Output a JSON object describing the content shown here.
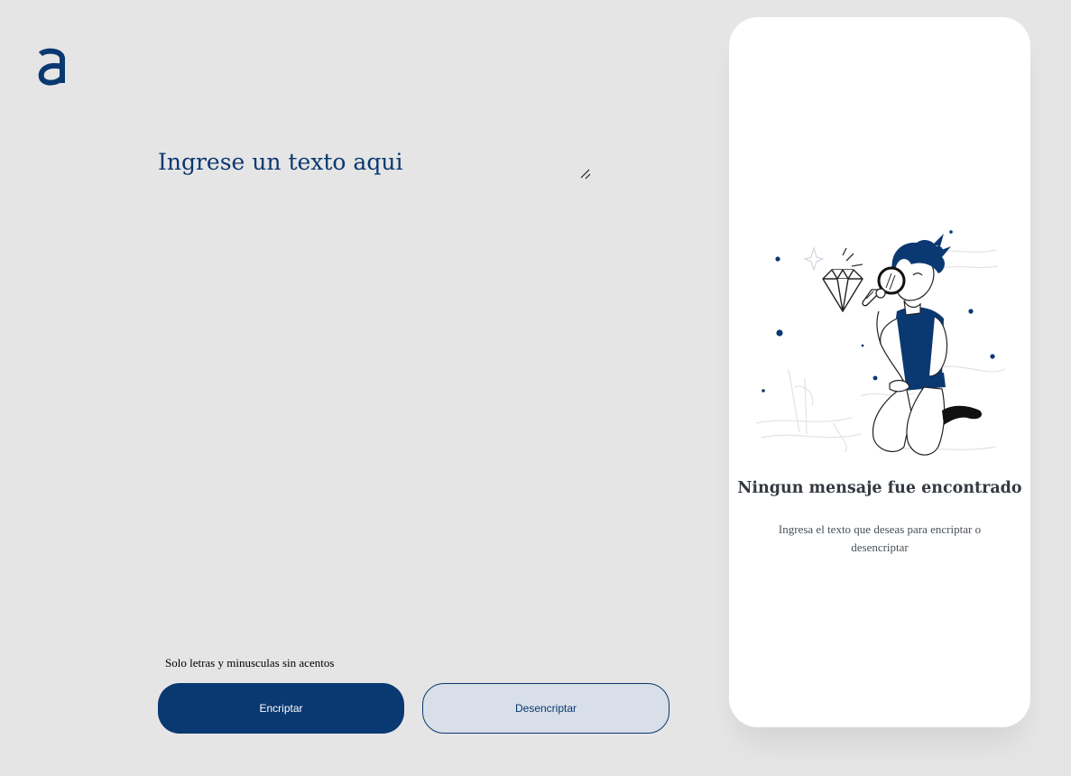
{
  "brand": {
    "logo_icon": "alura-a-logo",
    "accent_color": "#0a3871"
  },
  "editor": {
    "placeholder": "Ingrese un texto aqui",
    "value": "",
    "resize_icon": "resize-handle-icon"
  },
  "hint": {
    "icon": "info-icon",
    "text": "Solo letras y minusculas sin acentos"
  },
  "actions": {
    "encrypt_label": "Encriptar",
    "decrypt_label": "Desencriptar"
  },
  "output_panel": {
    "illustration": "person-with-magnifying-glass-illustration",
    "title": "Ningun mensaje fue encontrado",
    "description": "Ingresa el texto que deseas para encriptar o desencriptar"
  }
}
